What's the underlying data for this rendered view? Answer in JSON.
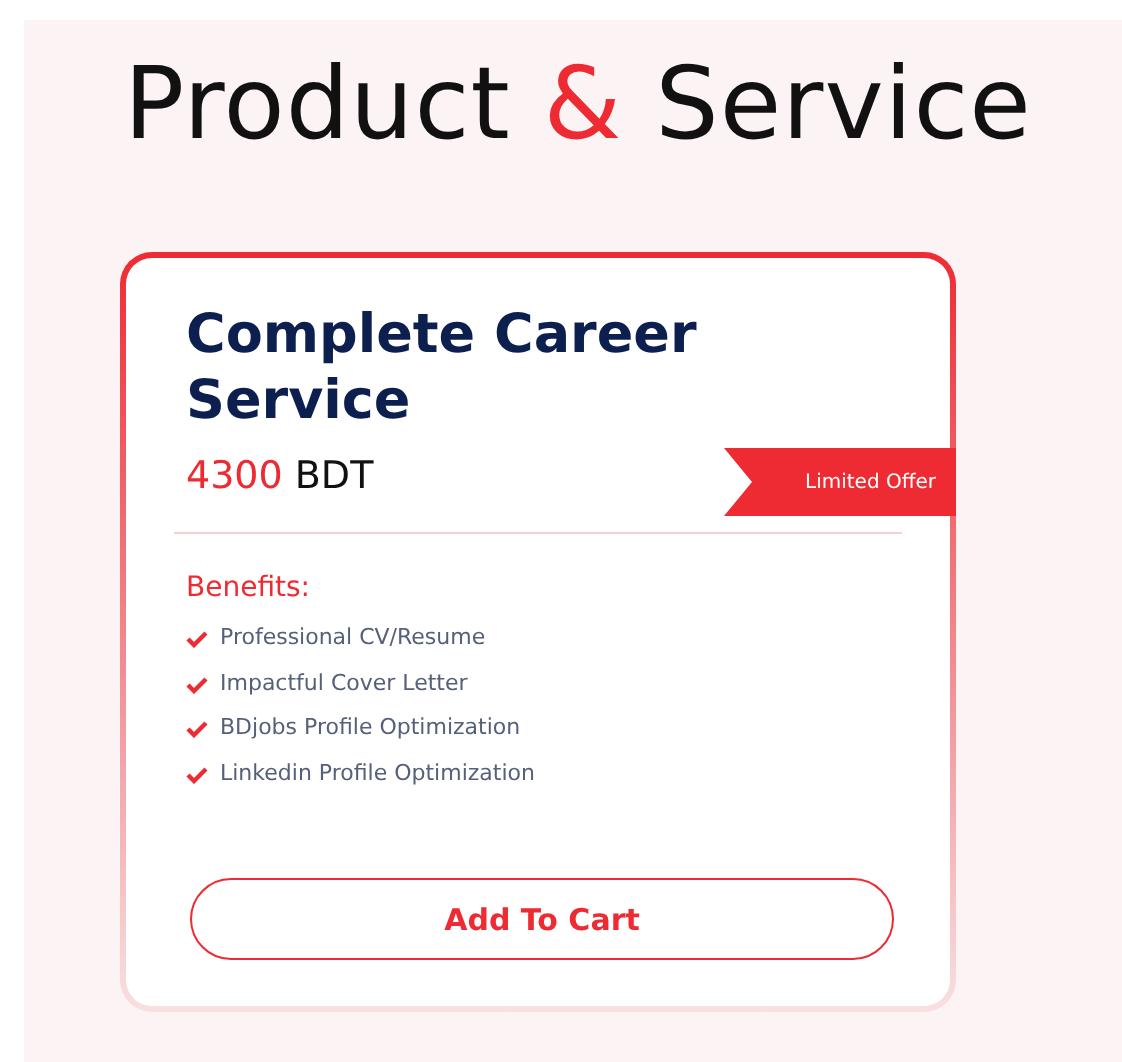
{
  "heading": [
    {
      "text": "Product",
      "accent": false
    },
    {
      "text": "&",
      "accent": true
    },
    {
      "text": "Service",
      "accent": false
    }
  ],
  "card": {
    "title": "Complete Career Service",
    "price": "4300",
    "currency": "BDT",
    "ribbon": "Limited Offer",
    "benefits_label": "Benefits:",
    "benefits": [
      "Professional CV/Resume",
      "Impactful Cover Letter",
      "BDjobs Profile Optimization",
      "Linkedin Profile Optimization"
    ],
    "button": "Add To Cart"
  }
}
